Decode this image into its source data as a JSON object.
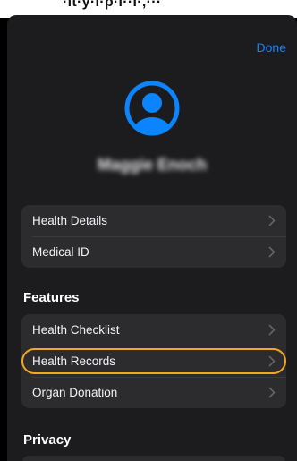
{
  "status": {
    "text": "·lt·y·i·p·i··i·,···"
  },
  "header": {
    "done_label": "Done"
  },
  "profile": {
    "name": "Maggie Enoch"
  },
  "groups": {
    "account": [
      {
        "label": "Health Details"
      },
      {
        "label": "Medical ID"
      }
    ],
    "features": [
      {
        "label": "Health Checklist"
      },
      {
        "label": "Health Records"
      },
      {
        "label": "Organ Donation"
      }
    ]
  },
  "sections": {
    "features_title": "Features",
    "privacy_title": "Privacy"
  },
  "icons": {
    "avatar": "person-circle-icon",
    "chevron": "chevron-right-icon"
  },
  "colors": {
    "accent": "#0a84ff",
    "highlight": "#f5a623",
    "sheet_bg": "#1c1c1e",
    "group_bg": "#2c2c2e"
  }
}
